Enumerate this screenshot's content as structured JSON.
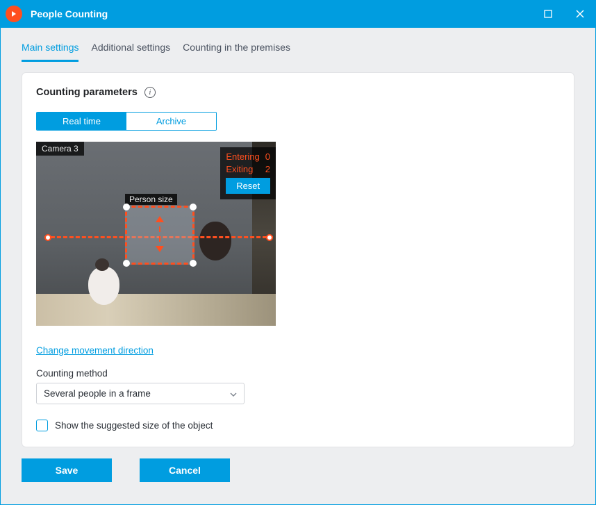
{
  "window": {
    "title": "People Counting"
  },
  "tabs": {
    "main": "Main settings",
    "additional": "Additional settings",
    "premises": "Counting in the premises"
  },
  "section": {
    "title": "Counting parameters"
  },
  "segmented": {
    "realtime": "Real time",
    "archive": "Archive"
  },
  "preview": {
    "camera": "Camera 3",
    "person_size_label": "Person size",
    "entering_label": "Entering",
    "entering_value": "0",
    "exiting_label": "Exiting",
    "exiting_value": "2",
    "reset": "Reset"
  },
  "link_change_direction": "Change movement direction",
  "counting_method": {
    "label": "Counting method",
    "value": "Several people in a frame"
  },
  "checkbox_suggested_size": "Show the suggested size of the object",
  "buttons": {
    "save": "Save",
    "cancel": "Cancel"
  },
  "colors": {
    "accent": "#009de0",
    "warn": "#ff4f1f"
  }
}
